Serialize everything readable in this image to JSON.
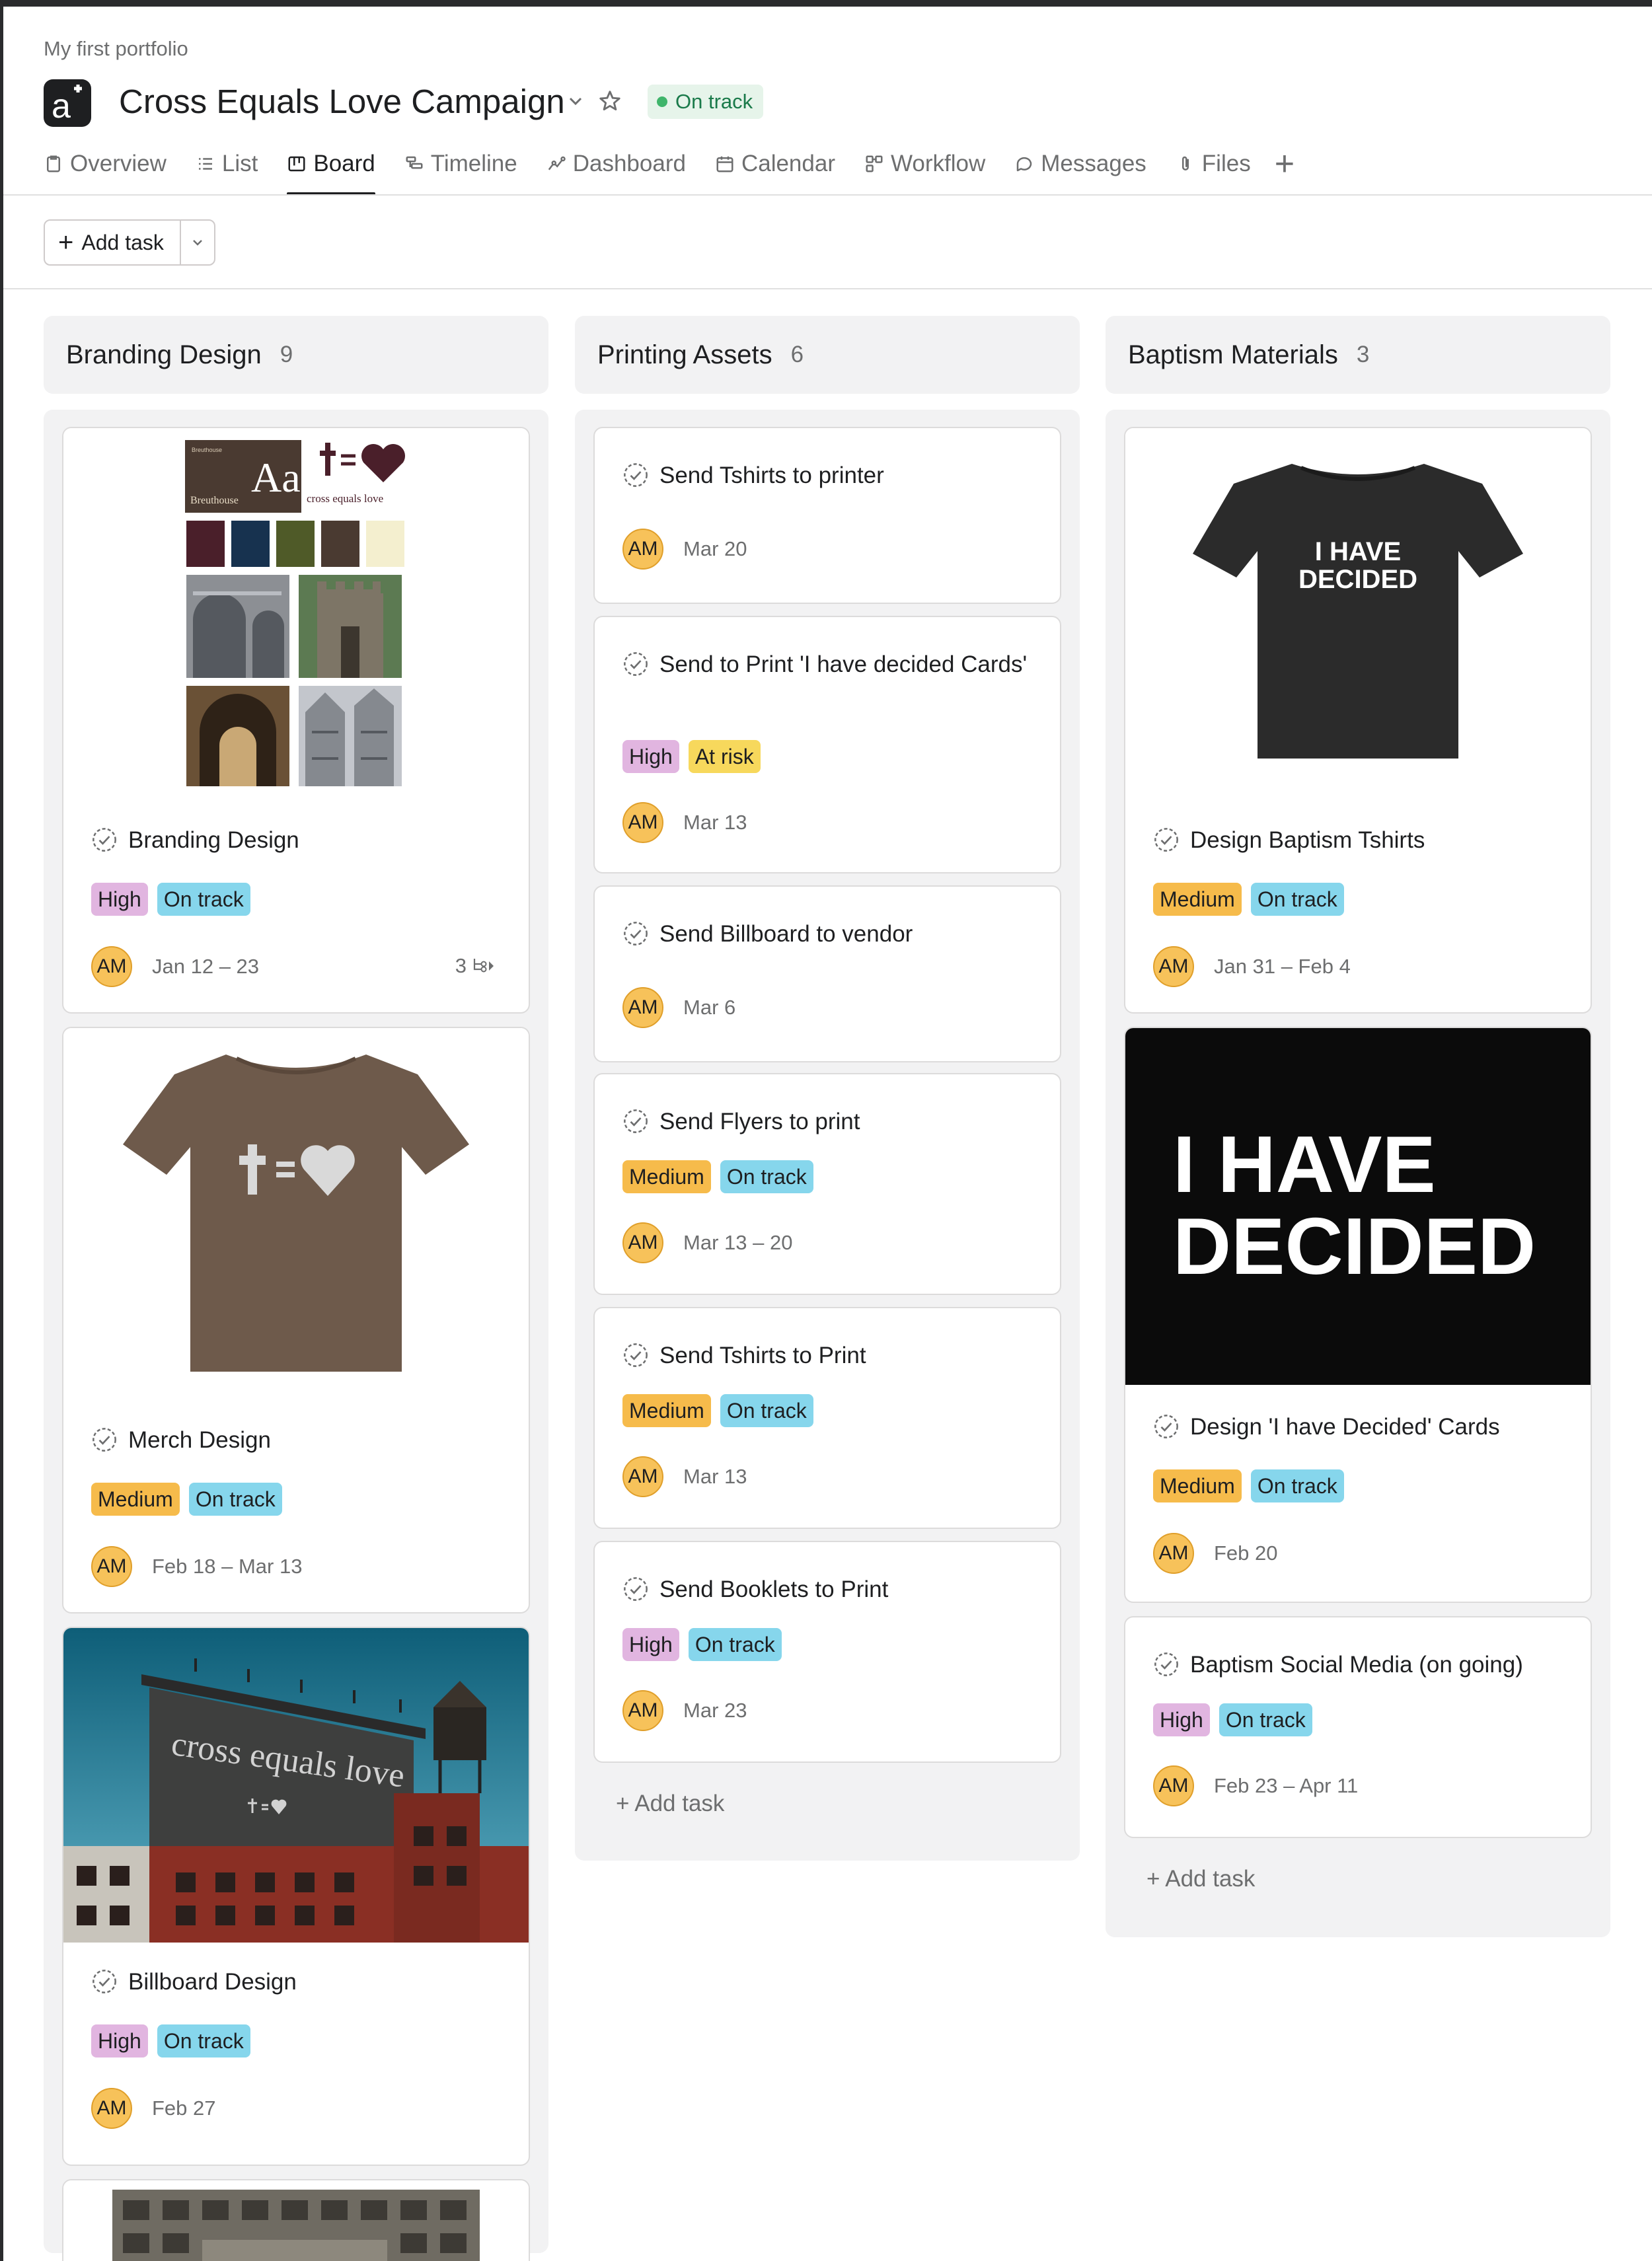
{
  "breadcrumb": "My first portfolio",
  "project": {
    "title": "Cross Equals Love Campaign",
    "status": "On track"
  },
  "tabs": [
    {
      "label": "Overview",
      "icon": "overview-icon"
    },
    {
      "label": "List",
      "icon": "list-icon"
    },
    {
      "label": "Board",
      "icon": "board-icon",
      "active": true
    },
    {
      "label": "Timeline",
      "icon": "timeline-icon"
    },
    {
      "label": "Dashboard",
      "icon": "dashboard-icon"
    },
    {
      "label": "Calendar",
      "icon": "calendar-icon"
    },
    {
      "label": "Workflow",
      "icon": "workflow-icon"
    },
    {
      "label": "Messages",
      "icon": "messages-icon"
    },
    {
      "label": "Files",
      "icon": "files-icon"
    }
  ],
  "toolbar": {
    "add_task": "Add task"
  },
  "colors": {
    "high": "#e1b5e0",
    "medium": "#f6bb4b",
    "on_track": "#86d6ec",
    "at_risk": "#f7d85c",
    "avatar": "#f7c25a"
  },
  "columns": [
    {
      "name": "Branding Design",
      "count": "9",
      "cards": [
        {
          "title": "Branding Design",
          "tags": [
            "High",
            "On track"
          ],
          "assignee": "AM",
          "date": "Jan 12 – 23",
          "subtasks": "3",
          "cover_text": [
            "Breuthouse",
            "Aa",
            "cross equals love"
          ]
        },
        {
          "title": "Merch Design",
          "tags": [
            "Medium",
            "On track"
          ],
          "assignee": "AM",
          "date": "Feb 18 – Mar 13"
        },
        {
          "title": "Billboard Design",
          "tags": [
            "High",
            "On track"
          ],
          "assignee": "AM",
          "date": "Feb 27",
          "cover_text": [
            "cross equals love"
          ]
        }
      ]
    },
    {
      "name": "Printing Assets",
      "count": "6",
      "cards": [
        {
          "title": "Send Tshirts to printer",
          "tags": [],
          "assignee": "AM",
          "date": "Mar 20"
        },
        {
          "title": "Send to Print 'I have decided Cards'",
          "tags": [
            "High",
            "At risk"
          ],
          "assignee": "AM",
          "date": "Mar 13"
        },
        {
          "title": "Send Billboard to vendor",
          "tags": [],
          "assignee": "AM",
          "date": "Mar 6"
        },
        {
          "title": "Send Flyers to print",
          "tags": [
            "Medium",
            "On track"
          ],
          "assignee": "AM",
          "date": "Mar 13 – 20"
        },
        {
          "title": "Send Tshirts to Print",
          "tags": [
            "Medium",
            "On track"
          ],
          "assignee": "AM",
          "date": "Mar 13"
        },
        {
          "title": "Send Booklets to Print",
          "tags": [
            "High",
            "On track"
          ],
          "assignee": "AM",
          "date": "Mar 23"
        }
      ],
      "add_task": "Add task"
    },
    {
      "name": "Baptism Materials",
      "count": "3",
      "cards": [
        {
          "title": "Design Baptism Tshirts",
          "tags": [
            "Medium",
            "On track"
          ],
          "assignee": "AM",
          "date": "Jan 31 – Feb 4",
          "cover_text": [
            "I HAVE",
            "DECIDED"
          ]
        },
        {
          "title": "Design 'I have Decided' Cards",
          "tags": [
            "Medium",
            "On track"
          ],
          "assignee": "AM",
          "date": "Feb 20",
          "cover_text": [
            "I HAVE",
            "DECIDED"
          ]
        },
        {
          "title": "Baptism Social Media (on going)",
          "tags": [
            "High",
            "On track"
          ],
          "assignee": "AM",
          "date": "Feb 23 – Apr 11"
        }
      ],
      "add_task": "Add task"
    }
  ]
}
